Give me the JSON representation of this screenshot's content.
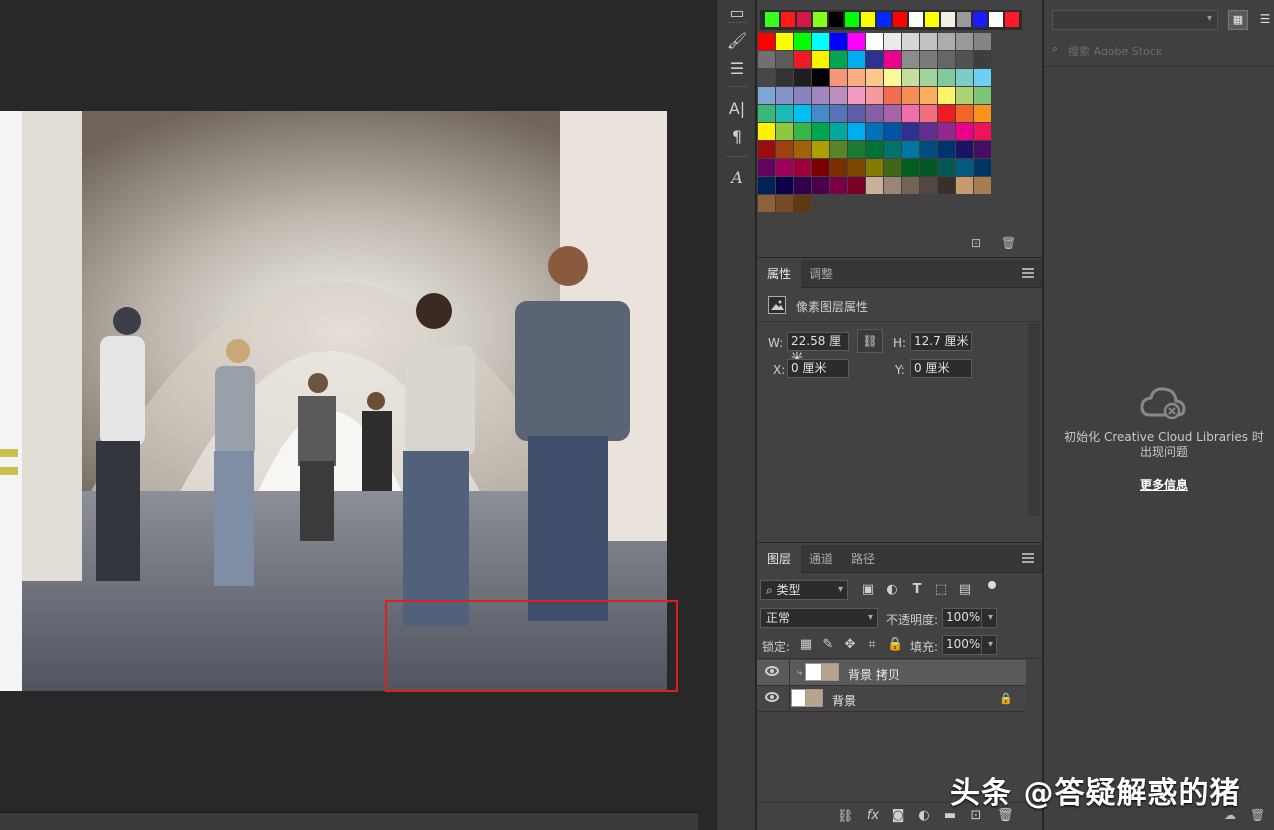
{
  "swatches": {
    "recent": [
      "#36ff1f",
      "#ff1a1a",
      "#d2174a",
      "#85ff19",
      "#000000",
      "#00ff00",
      "#f9ff00",
      "#0028ff",
      "#ff0000",
      "#ffffff",
      "#ffff00",
      "#f5eee3",
      "#999999",
      "#1a1aff",
      "#ffffff",
      "#ff1a2a"
    ],
    "grid": [
      [
        "#ff0000",
        "#ffff00",
        "#00ff00",
        "#00ffff",
        "#0000ff",
        "#ff00ff",
        "#ffffff",
        "#ebebeb",
        "#d6d6d6",
        "#c2c2c2",
        "#adadad",
        "#999999",
        "#858585"
      ],
      [
        "#707070",
        "#5c5c5c",
        "#ed1c24",
        "#fff200",
        "#00a651",
        "#00aeef",
        "#2e3192",
        "#ec008c",
        "#8c8c8c",
        "#7a7a7a",
        "#666666",
        "#525252",
        "#3d3d3d"
      ],
      [
        "#474747",
        "#333333",
        "#1f1f1f",
        "#000000",
        "#f7977a",
        "#f9ad81",
        "#fdc68a",
        "#fff79a",
        "#c4df9b",
        "#a3d39c",
        "#82ca9d",
        "#7bcdc8",
        "#6ecff6"
      ],
      [
        "#7ea7d8",
        "#8493ca",
        "#8882be",
        "#a187be",
        "#bc8dbf",
        "#f49ac2",
        "#f6989d",
        "#f26c4f",
        "#f68e55",
        "#fbaf5c",
        "#fff467",
        "#acd372",
        "#7cc576"
      ],
      [
        "#3bb878",
        "#1abbb4",
        "#00bff3",
        "#438ccb",
        "#5574b9",
        "#605ca8",
        "#855fa8",
        "#a763a8",
        "#f06ea9",
        "#f26d7d",
        "#ed1c24",
        "#f26522",
        "#f7941d"
      ],
      [
        "#fff200",
        "#8dc73f",
        "#39b54a",
        "#00a651",
        "#00a99d",
        "#00aeef",
        "#0072bc",
        "#0054a6",
        "#2e3192",
        "#662d91",
        "#92278f",
        "#ec008c",
        "#ed145b"
      ],
      [
        "#9e0b0f",
        "#a0410d",
        "#a3620a",
        "#aba000",
        "#598527",
        "#1a7b30",
        "#007236",
        "#00746b",
        "#0076a3",
        "#004b80",
        "#003471",
        "#1b1464",
        "#440e62"
      ],
      [
        "#630460",
        "#9e005d",
        "#9e0039",
        "#790000",
        "#7b2e00",
        "#7d4900",
        "#827b00",
        "#406618",
        "#005e20",
        "#005826",
        "#005952",
        "#005b7f",
        "#003663"
      ],
      [
        "#002157",
        "#0d004c",
        "#32004b",
        "#4b0049",
        "#7b0046",
        "#7a0026",
        "#c7b299",
        "#998675",
        "#736357",
        "#534741",
        "#37302d",
        "#c69c6e",
        "#a67c52"
      ],
      [
        "#8c6239",
        "#754c24",
        "#603913"
      ]
    ]
  },
  "properties": {
    "tabs": [
      "属性",
      "调整"
    ],
    "section_title": "像素图层属性",
    "w_label": "W:",
    "w_value": "22.58 厘米",
    "h_label": "H:",
    "h_value": "12.7 厘米",
    "x_label": "X:",
    "x_value": "0 厘米",
    "y_label": "Y:",
    "y_value": "0 厘米"
  },
  "layers": {
    "tabs": [
      "图层",
      "通道",
      "路径"
    ],
    "filter_kind": "类型",
    "blend_mode": "正常",
    "opacity_label": "不透明度:",
    "opacity_value": "100%",
    "lock_label": "锁定:",
    "fill_label": "填充:",
    "fill_value": "100%",
    "items": [
      {
        "name": "背景 拷贝",
        "visible": true,
        "selected": true
      },
      {
        "name": "背景",
        "visible": true,
        "locked": true
      }
    ]
  },
  "libraries": {
    "search_placeholder": "搜索 Adobe Stock",
    "message": "初始化 Creative Cloud Libraries 时出现问题",
    "more_info": "更多信息"
  },
  "watermark": "头条 @答疑解惑的猪"
}
